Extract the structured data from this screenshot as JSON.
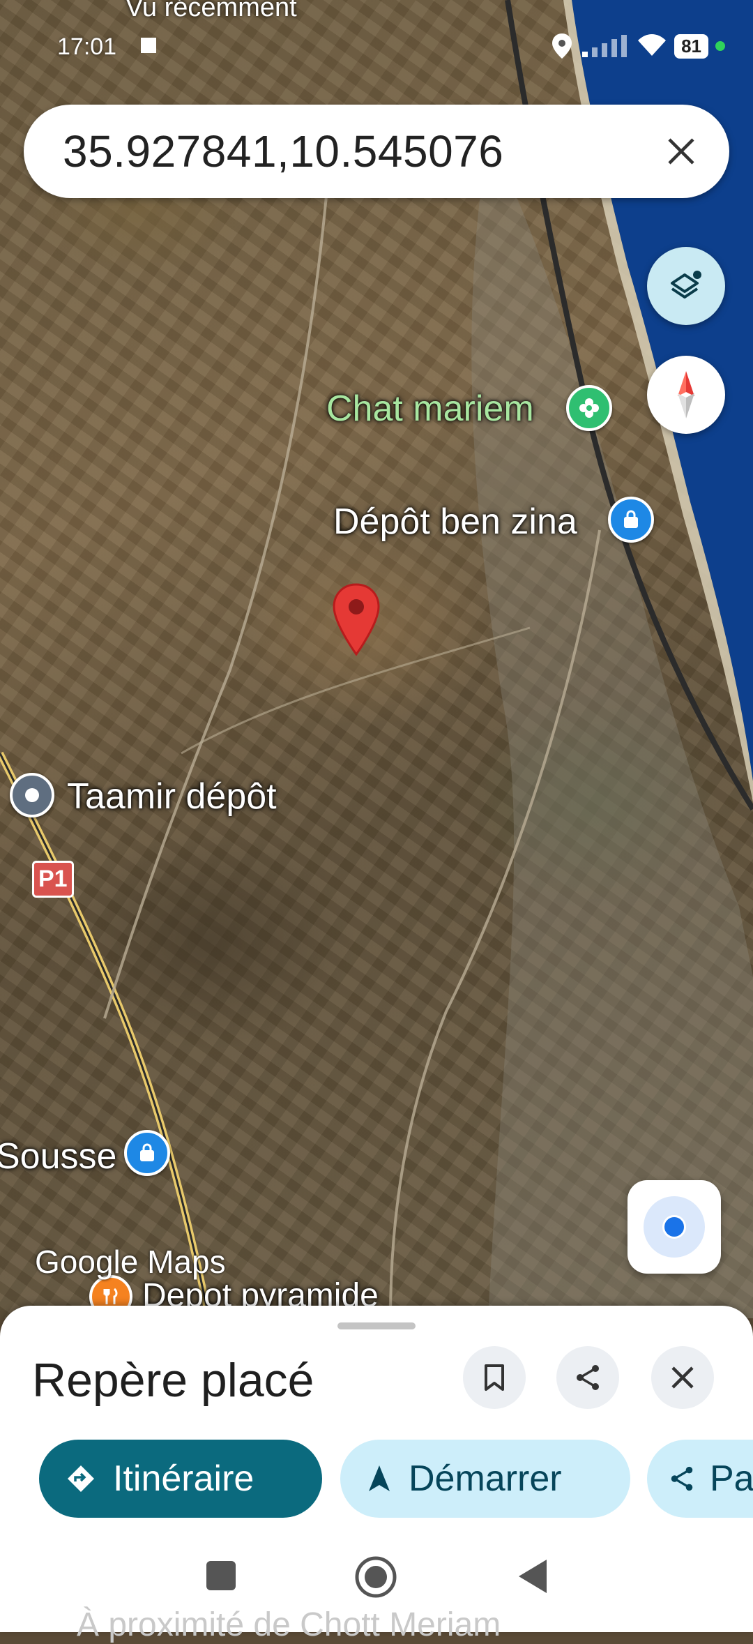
{
  "status_bar": {
    "time": "17:01",
    "battery": "81"
  },
  "top_cut_label": "Vu récemment",
  "search": {
    "query": "35.927841,10.545076"
  },
  "map": {
    "labels": {
      "chat_mariem": "Chat mariem",
      "depot_ben_zina": "Dépôt ben zina",
      "taamir_depot": "Taamir dépôt",
      "sousse": "Sousse",
      "depot_pyramide": "Depot pyramide",
      "road_p1": "P1"
    },
    "watermark": "Google Maps",
    "colors": {
      "sea": "#0d3f8c",
      "pin": "#e53935"
    }
  },
  "sheet": {
    "title": "Repère placé",
    "chips": {
      "itineraire": "Itinéraire",
      "demarrer": "Démarrer",
      "partager": "Pa"
    },
    "below_text": "À proximité de Chott Meriam"
  }
}
